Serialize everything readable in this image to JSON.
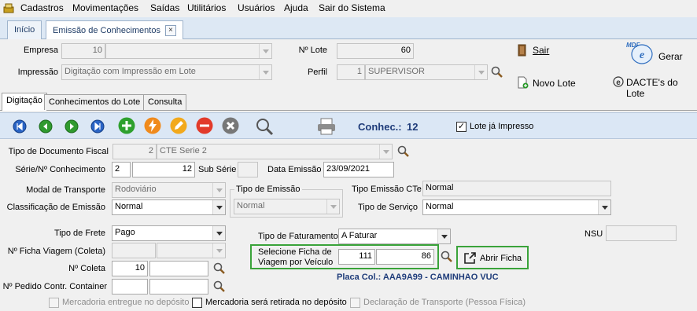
{
  "menu": {
    "items": [
      "Cadastros",
      "Movimentações",
      "Saídas",
      "Utilitários",
      "Usuários",
      "Ajuda",
      "Sair do Sistema"
    ]
  },
  "tabs": {
    "home": "Início",
    "active": "Emissão de Conhecimentos",
    "close_glyph": "×"
  },
  "header": {
    "empresa_label": "Empresa",
    "empresa_code": "10",
    "empresa_name": "",
    "impressao_label": "Impressão",
    "impressao_value": "Digitação com Impressão em Lote",
    "lote_label": "Nº Lote",
    "lote_value": "60",
    "perfil_label": "Perfil",
    "perfil_code": "1",
    "perfil_value": "SUPERVISOR",
    "sair_label": "Sair",
    "novo_lote_label": "Novo Lote",
    "gerar_label": "Gerar",
    "dacte_label": "DACTE's do Lote",
    "mdfe_logo_text": "MDF"
  },
  "subtabs": [
    "Digitação",
    "Conhecimentos do Lote",
    "Consulta"
  ],
  "toolbar": {
    "conhec_label": "Conhec.:",
    "conhec_value": "12",
    "lote_impresso_label": "Lote já Impresso",
    "lote_impresso_checked": "✓"
  },
  "form": {
    "tipo_doc_label": "Tipo de Documento Fiscal",
    "tipo_doc_code": "2",
    "tipo_doc_value": "CTE Serie 2",
    "serie_label": "Série/Nº Conhecimento",
    "serie_value": "2",
    "numero_value": "12",
    "sub_serie_label": "Sub Série",
    "sub_serie_value": "",
    "data_emissao_label": "Data Emissão",
    "data_emissao_value": "23/09/2021",
    "modal_label": "Modal de Transporte",
    "modal_value": "Rodoviário",
    "tipo_emissao_group": "Tipo de Emissão",
    "tipo_emissao_value": "Normal",
    "tipo_emissao_cte_label": "Tipo Emissão CTe",
    "tipo_emissao_cte_value": "Normal",
    "classificacao_label": "Classificação de Emissão",
    "classificacao_value": "Normal",
    "tipo_servico_label": "Tipo de Serviço",
    "tipo_servico_value": "Normal",
    "tipo_frete_label": "Tipo de Frete",
    "tipo_frete_value": "Pago",
    "tipo_faturamento_label": "Tipo de Faturamento",
    "tipo_faturamento_value": "A Faturar",
    "nsu_label": "NSU",
    "nsu_value": "",
    "ficha_viagem_label": "Nº Ficha Viagem (Coleta)",
    "selecione_ficha_label_1": "Selecione Ficha de",
    "selecione_ficha_label_2": "Viagem por Veículo",
    "ficha_value_1": "111",
    "ficha_value_2": "86",
    "abrir_ficha_label": "Abrir Ficha",
    "coleta_label": "Nº Coleta",
    "coleta_value": "10",
    "placa_text": "Placa Col.: AAA9A99 - CAMINHAO VUC",
    "pedido_label": "Nº Pedido Contr. Container",
    "chk_mercadoria_entregue": "Mercadoria entregue no depósito",
    "chk_mercadoria_retirada": "Mercadoria será retirada no depósito",
    "chk_declaracao": "Declaração de Transporte (Pessoa Física)"
  },
  "colors": {
    "accent_blue": "#1f3c7a",
    "highlight_green": "#3aa33a",
    "toolbar_bg": "#dbe7f5"
  }
}
